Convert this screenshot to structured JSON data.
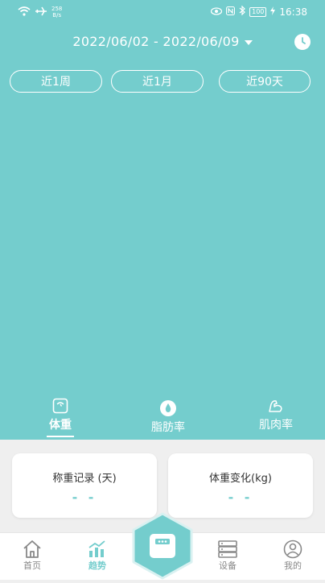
{
  "status_bar": {
    "net_speed_value": "258",
    "net_speed_unit": "B/s",
    "battery": "100",
    "time": "16:38"
  },
  "header": {
    "date_range": "2022/06/02 - 2022/06/09"
  },
  "range_pills": [
    "近1周",
    "近1月",
    "近90天"
  ],
  "metric_tabs": [
    {
      "label": "体重",
      "icon": "scale-icon",
      "active": true
    },
    {
      "label": "脂肪率",
      "icon": "droplet-icon",
      "active": false
    },
    {
      "label": "肌肉率",
      "icon": "muscle-arm-icon",
      "active": false
    }
  ],
  "cards": [
    {
      "title": "称重记录 (天)",
      "value": "- -"
    },
    {
      "title": "体重变化(kg)",
      "value": "- -"
    }
  ],
  "nav": [
    {
      "label": "首页",
      "icon": "home-icon",
      "active": false
    },
    {
      "label": "趋势",
      "icon": "trend-icon",
      "active": true
    },
    {
      "label": "设备",
      "icon": "device-icon",
      "active": false
    },
    {
      "label": "我的",
      "icon": "profile-icon",
      "active": false
    }
  ],
  "colors": {
    "accent": "#74cdcd",
    "background": "#efefef",
    "card": "#ffffff"
  }
}
